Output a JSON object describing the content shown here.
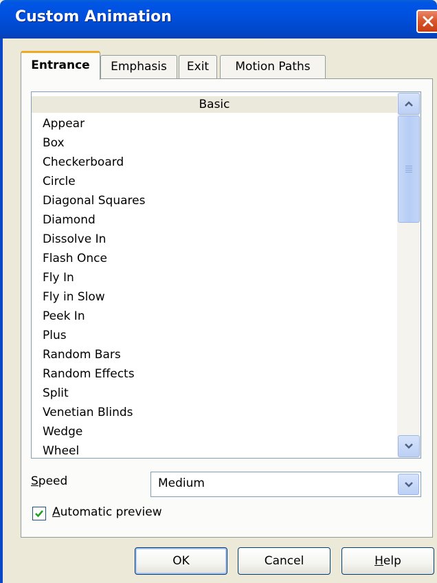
{
  "window": {
    "title": "Custom Animation",
    "close_icon": "close-icon"
  },
  "tabs": [
    {
      "label": "Entrance",
      "active": true
    },
    {
      "label": "Emphasis",
      "active": false
    },
    {
      "label": "Exit",
      "active": false
    },
    {
      "label": "Motion Paths",
      "active": false
    }
  ],
  "list": {
    "group_header": "Basic",
    "items": [
      "Appear",
      "Box",
      "Checkerboard",
      "Circle",
      "Diagonal Squares",
      "Diamond",
      "Dissolve In",
      "Flash Once",
      "Fly In",
      "Fly in Slow",
      "Peek In",
      "Plus",
      "Random Bars",
      "Random Effects",
      "Split",
      "Venetian Blinds",
      "Wedge",
      "Wheel"
    ]
  },
  "speed": {
    "label_accel": "S",
    "label_rest": "peed",
    "value": "Medium"
  },
  "preview": {
    "checked": true,
    "label_accel": "A",
    "label_rest": "utomatic preview"
  },
  "buttons": {
    "ok": "OK",
    "cancel": "Cancel",
    "help_accel": "H",
    "help_rest": "elp"
  },
  "colors": {
    "titlebar": "#0050de",
    "dialog_bg": "#ece9d8",
    "active_tab_accent": "#f1a722",
    "close_button": "#d9582e"
  }
}
